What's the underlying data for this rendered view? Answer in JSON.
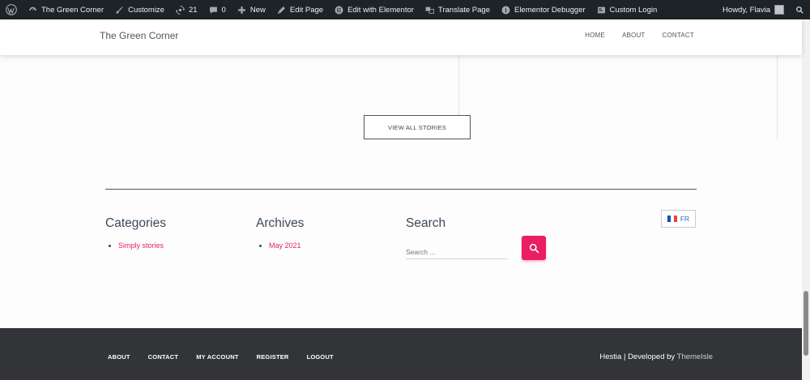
{
  "admin_bar": {
    "site_name": "The Green Corner",
    "customize": "Customize",
    "updates_count": "21",
    "comments_count": "0",
    "new": "New",
    "edit_page": "Edit Page",
    "edit_with_elementor": "Edit with Elementor",
    "translate_page": "Translate Page",
    "elementor_debugger": "Elementor Debugger",
    "custom_login": "Custom Login",
    "howdy": "Howdy, Flavia"
  },
  "header": {
    "site_title": "The Green Corner",
    "nav": [
      "HOME",
      "ABOUT",
      "CONTACT"
    ]
  },
  "main": {
    "view_all_label": "VIEW ALL STORIES",
    "categories": {
      "title": "Categories",
      "items": [
        "Simply stories"
      ]
    },
    "archives": {
      "title": "Archives",
      "items": [
        "May 2021"
      ]
    },
    "search": {
      "title": "Search",
      "placeholder": "Search ..."
    },
    "language": {
      "label": "FR"
    }
  },
  "footer": {
    "nav": [
      "ABOUT",
      "CONTACT",
      "MY ACCOUNT",
      "REGISTER",
      "LOGOUT"
    ],
    "credits_prefix": "Hestia | Developed by ",
    "credits_link": "ThemeIsle"
  },
  "colors": {
    "accent": "#e91e63",
    "admin_bar": "#1d2327",
    "footer": "#323437"
  }
}
